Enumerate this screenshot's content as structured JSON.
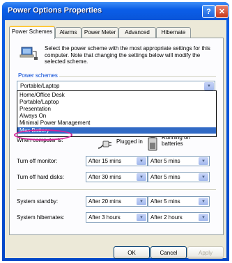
{
  "window": {
    "title": "Power Options Properties",
    "help": "?",
    "close": "✕"
  },
  "tabs": [
    "Power Schemes",
    "Alarms",
    "Power Meter",
    "Advanced",
    "Hibernate"
  ],
  "description": "Select the power scheme with the most appropriate settings for this computer. Note that changing the settings below will modify the selected scheme.",
  "power_schemes": {
    "group_label": "Power schemes",
    "selected": "Portable/Laptop",
    "options": [
      "Home/Office Desk",
      "Portable/Laptop",
      "Presentation",
      "Always On",
      "Minimal Power Management",
      "Max Battery"
    ],
    "highlighted_option": "Max Battery"
  },
  "settings": {
    "when_label": "When computer is:",
    "plugged_in": "Plugged in",
    "running_on_batteries": "Running on batteries",
    "rows": [
      {
        "label": "Turn off monitor:",
        "plugged": "After 15 mins",
        "battery": "After 5 mins"
      },
      {
        "label": "Turn off hard disks:",
        "plugged": "After 30 mins",
        "battery": "After 5 mins"
      },
      {
        "label": "System standby:",
        "plugged": "After 20 mins",
        "battery": "After 5 mins"
      },
      {
        "label": "System hibernates:",
        "plugged": "After 3 hours",
        "battery": "After 2 hours"
      }
    ]
  },
  "buttons": {
    "ok": "OK",
    "cancel": "Cancel",
    "apply": "Apply"
  },
  "colors": {
    "title_bar": "#0a55d8",
    "selection": "#316ac5",
    "annotation_oval": "#d6209a",
    "dialog_bg": "#ece9d8"
  }
}
